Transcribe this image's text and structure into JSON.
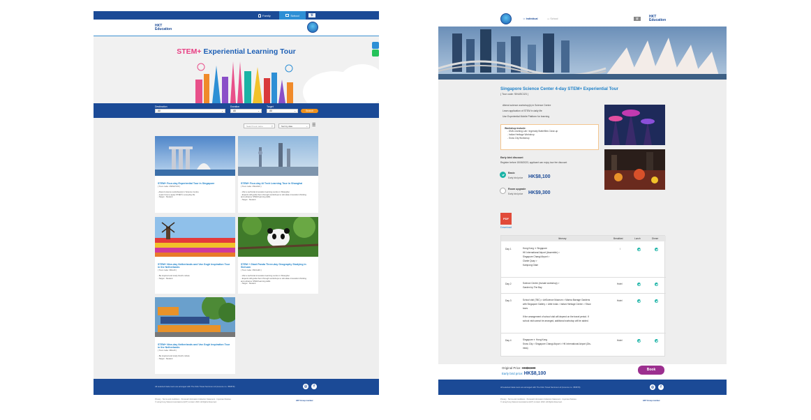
{
  "left": {
    "topbar": {
      "family": "Family",
      "school": "School",
      "lang": "繁"
    },
    "brand": {
      "line1": "HKT",
      "line2": "Education"
    },
    "hero": {
      "title_prefix": "STEM+",
      "title_rest": " Experiential Learning Tour"
    },
    "filter": {
      "destination_label": "Destination",
      "destination_value": "All",
      "duration_label": "Duration",
      "duration_value": "All",
      "target_label": "Target",
      "target_value": "All",
      "search_label": "Search"
    },
    "tools": {
      "search_placeholder": "Search tour name",
      "sort": "Sort by date"
    },
    "cards": [
      {
        "title": "STEM+ Four-day Experiential Tour in Singapore",
        "code": "( Tour code: 4SINAY23 )",
        "lines": [
          "- Attend science workshop(s) in Science Centre",
          "- Learn how to apply STEM in everyday life",
          "- Target : Student"
        ]
      },
      {
        "title": "STEM+ Four-day AI Tech Learning Tour in Shanghai",
        "code": "( Tour code: 4SHA23 )",
        "lines": [
          "- Visit a technical innovation learning centre in Shanghai",
          "- Experts will guide them through workshops to stimulate innovation thinking",
          "  and enhance STEM learning skills",
          "- Target : Student"
        ]
      },
      {
        "title": "STEM+ Nine-day Netherlands and Van Gogh Inspiration Tour in the Netherlands",
        "code": "( Tour code: 9NL23 )",
        "lines": [
          "- Be inspired and study Dutch culture",
          "- Target : Student"
        ]
      },
      {
        "title": "STEM + Giant Panda Three-day Geography Studying in Sichuan",
        "code": "( Tour code: 3SCH23 )",
        "lines": [
          "- Visit a technical innovation learning centre in Shanghai",
          "- Experts will guide them through workshops to stimulate innovation thinking",
          "  and enhance STEM learning skills",
          "- Target : Student"
        ]
      },
      {
        "title": "STEM+ Nine-day Netherlands and Van Gogh Inspiration Tour in the Netherlands",
        "code": "( Tour code: 9NL23 )",
        "lines": [
          "- Be inspired and study Dutch culture",
          "- Target : Student"
        ]
      }
    ],
    "footer": {
      "text": "All selected trade tours are arranged with The Kids Travel Services Ltd (Licence no. 356879)",
      "below1": "Privacy · Terms and conditions · Personal Information Collection Statement · Important Notices",
      "below2": "© Hong Kong Telecommunications (HKT) Limited. 2023. All Rights Reserved.",
      "brand": "HKT Group member"
    }
  },
  "right": {
    "header": {
      "individual": "Individual",
      "school": "School",
      "lang": "繁",
      "brand1": "HKT",
      "brand2": "Education"
    },
    "title": "Singapore Science Center 4-day STEM+ Experiential Tour",
    "code": "( Tour code: SIN4SCI23 )",
    "bullets": [
      "Attend science workshop(s) in Science Centre",
      "Learn application of STEM in daily life",
      "Use Experiential Mobile Platform for learning"
    ],
    "workshop": {
      "heading": "Workshop include:",
      "items": [
        "- DNA Learning Lab / Ingenuity Butterflies Close-up",
        "- Indian Heritage Workshop",
        "- Snow City Workshop"
      ]
    },
    "early_bird": {
      "heading": "Early bird discount",
      "text": "Register before 15/08/2023, applicant can enjoy tour fee discount"
    },
    "options": [
      {
        "label": "Basic",
        "sub": "Early bird price",
        "price": "HK$8,100",
        "selected": true
      },
      {
        "label": "Room upgrade",
        "sub": "Early bird price",
        "price": "HK$9,300",
        "selected": false
      }
    ],
    "pdf": {
      "icon": "PDF",
      "label": "Download"
    },
    "itinerary": {
      "headers": {
        "itinerary": "Itinerary",
        "breakfast": "Breakfast",
        "lunch": "Lunch",
        "dinner": "Dinner"
      },
      "days": [
        {
          "day": "Day 1",
          "lines": [
            "Hong Kong ✈ Singapore",
            "HK International Airport (Assemble) >",
            "Singapore Changi Airport >",
            "Clarke Quay >",
            "Kampong Glam"
          ],
          "breakfast": "/",
          "lunch": true,
          "dinner": true
        },
        {
          "day": "Day 2",
          "lines": [
            "Science Centre (Include workshop) >",
            "Garden by The Bay"
          ],
          "breakfast": "Hotel",
          "lunch": true,
          "dinner": true
        },
        {
          "day": "Day 3",
          "lines": [
            "School visit (TBC) > ArtScience Museum > Marina Barrage Gardens",
            "with Singapore Gallery > Little India > Indian Heritage Centre > Show",
            "tours",
            "",
            "If the arrangement of school visit will depend on the travel period. If",
            "school visit cannot be arranged, additional workshop will be added."
          ],
          "breakfast": "Hotel",
          "lunch": true,
          "dinner": true
        },
        {
          "day": "Day 4",
          "lines": [
            "Singapore ✈ Hong Kong",
            "Snow City > Singapore Changi Airport > HK International Airport (Dis-",
            "miss)"
          ],
          "breakfast": "Hotel",
          "lunch": true,
          "dinner": true
        }
      ]
    },
    "bottom": {
      "original_label": "Original Price:",
      "original_price": "HK$8,500",
      "early_label": "Early bird price:",
      "early_price": "HK$8,100",
      "book": "Book"
    },
    "footer": {
      "text": "All selected trade tours are arranged with The Kids Travel Services Ltd (Licence no. 356879)",
      "below1": "Privacy · Terms and conditions · Personal Information Collection Statement · Important Notices",
      "below2": "© Hong Kong Telecommunications (HKT) Limited. 2023. All Rights Reserved.",
      "brand": "HKT Group member"
    }
  }
}
